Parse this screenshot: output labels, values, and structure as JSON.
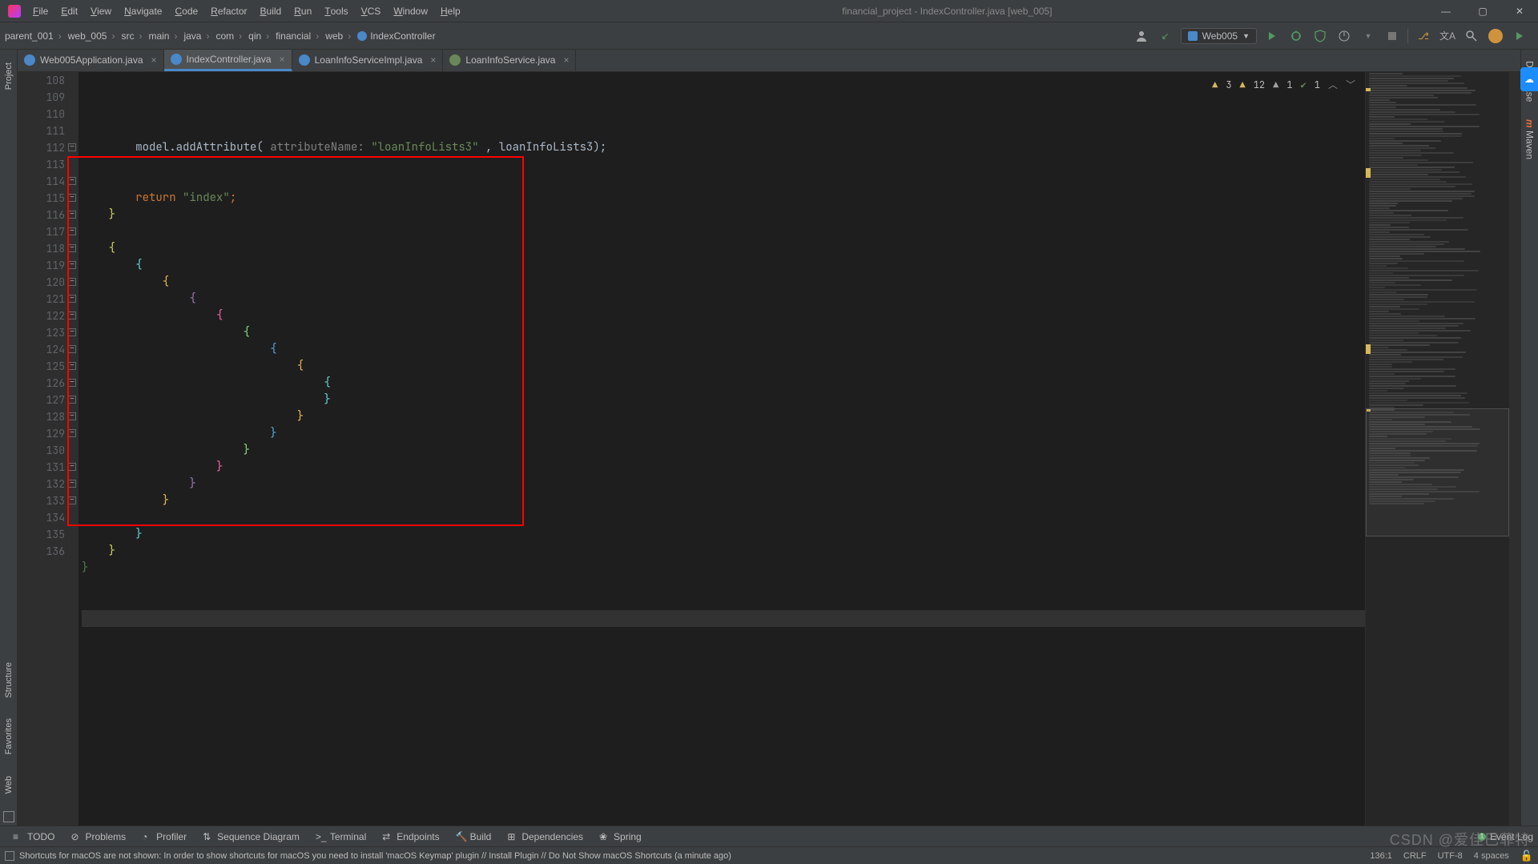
{
  "window": {
    "title": "financial_project - IndexController.java [web_005]"
  },
  "menu": [
    "File",
    "Edit",
    "View",
    "Navigate",
    "Code",
    "Refactor",
    "Build",
    "Run",
    "Tools",
    "VCS",
    "Window",
    "Help"
  ],
  "breadcrumbs": [
    "parent_001",
    "web_005",
    "src",
    "main",
    "java",
    "com",
    "qin",
    "financial",
    "web",
    "IndexController"
  ],
  "run_config": {
    "label": "Web005"
  },
  "tabs": [
    {
      "label": "Web005Application.java",
      "active": false,
      "color": "#4a88c7"
    },
    {
      "label": "IndexController.java",
      "active": true,
      "color": "#4a88c7"
    },
    {
      "label": "LoanInfoServiceImpl.java",
      "active": false,
      "color": "#4a88c7"
    },
    {
      "label": "LoanInfoService.java",
      "active": false,
      "color": "#6a8759"
    }
  ],
  "editor": {
    "first_line": 108,
    "lines": [
      {
        "n": 108,
        "raw": [
          {
            "t": "        model.addAttribute( ",
            "c": "#a9b7c6"
          },
          {
            "t": "attributeName:",
            "c": "#808080"
          },
          {
            "t": " \"loanInfoLists3\" ",
            "c": "#6a8759"
          },
          {
            "t": ", loanInfoLists3);",
            "c": "#a9b7c6"
          }
        ]
      },
      {
        "n": 109,
        "raw": []
      },
      {
        "n": 110,
        "raw": []
      },
      {
        "n": 111,
        "raw": [
          {
            "t": "        ",
            "c": ""
          },
          {
            "t": "return ",
            "c": "#cc7832"
          },
          {
            "t": "\"index\"",
            "c": "#6a8759"
          },
          {
            "t": ";",
            "c": "#cc7832"
          }
        ]
      },
      {
        "n": 112,
        "raw": [
          {
            "t": "    }",
            "c": "#cccc66"
          }
        ],
        "fold": true
      },
      {
        "n": 113,
        "raw": []
      },
      {
        "n": 114,
        "raw": [
          {
            "t": "    {",
            "c": "#cccc66"
          }
        ],
        "fold": true
      },
      {
        "n": 115,
        "raw": [
          {
            "t": "        {",
            "c": "#66cccc"
          }
        ],
        "fold": true
      },
      {
        "n": 116,
        "raw": [
          {
            "t": "            {",
            "c": "#e4b555"
          }
        ],
        "fold": true
      },
      {
        "n": 117,
        "raw": [
          {
            "t": "                {",
            "c": "#9876aa"
          }
        ],
        "fold": true
      },
      {
        "n": 118,
        "raw": [
          {
            "t": "                    {",
            "c": "#e864a3"
          }
        ],
        "fold": true
      },
      {
        "n": 119,
        "raw": [
          {
            "t": "                        {",
            "c": "#87d37c"
          }
        ],
        "fold": true
      },
      {
        "n": 120,
        "raw": [
          {
            "t": "                            {",
            "c": "#53a2d8"
          }
        ],
        "fold": true
      },
      {
        "n": 121,
        "raw": [
          {
            "t": "                                {",
            "c": "#e4b555"
          }
        ],
        "fold": true
      },
      {
        "n": 122,
        "raw": [
          {
            "t": "                                    {",
            "c": "#66cccc"
          }
        ],
        "fold": true
      },
      {
        "n": 123,
        "raw": [
          {
            "t": "                                    }",
            "c": "#66cccc"
          }
        ],
        "fold": true
      },
      {
        "n": 124,
        "raw": [
          {
            "t": "                                }",
            "c": "#e4b555"
          }
        ],
        "fold": true
      },
      {
        "n": 125,
        "raw": [
          {
            "t": "                            }",
            "c": "#53a2d8"
          }
        ],
        "fold": true
      },
      {
        "n": 126,
        "raw": [
          {
            "t": "                        }",
            "c": "#87d37c"
          }
        ],
        "fold": true
      },
      {
        "n": 127,
        "raw": [
          {
            "t": "                    }",
            "c": "#e864a3"
          }
        ],
        "fold": true
      },
      {
        "n": 128,
        "raw": [
          {
            "t": "                }",
            "c": "#9876aa"
          }
        ],
        "fold": true
      },
      {
        "n": 129,
        "raw": [
          {
            "t": "            }",
            "c": "#e4b555"
          }
        ],
        "fold": true
      },
      {
        "n": 130,
        "raw": []
      },
      {
        "n": 131,
        "raw": [
          {
            "t": "        }",
            "c": "#66cccc"
          }
        ],
        "fold": true
      },
      {
        "n": 132,
        "raw": [
          {
            "t": "    }",
            "c": "#cccc66"
          }
        ],
        "fold": true
      },
      {
        "n": 133,
        "raw": [
          {
            "t": "}",
            "c": "#4d784e"
          }
        ],
        "fold": true
      },
      {
        "n": 134,
        "raw": []
      },
      {
        "n": 135,
        "raw": []
      },
      {
        "n": 136,
        "raw": [],
        "current": true
      }
    ],
    "inspection": {
      "w1": "3",
      "w2": "12",
      "w3": "1",
      "ok": "1"
    }
  },
  "left_tools": [
    "Project",
    "Structure",
    "Favorites",
    "Web"
  ],
  "right_tools": [
    "Database",
    "Maven"
  ],
  "bottom_tools": [
    "TODO",
    "Problems",
    "Profiler",
    "Sequence Diagram",
    "Terminal",
    "Endpoints",
    "Build",
    "Dependencies",
    "Spring"
  ],
  "event_log": {
    "label": "Event Log",
    "badge": "1"
  },
  "status": {
    "msg": "Shortcuts for macOS are not shown: In order to show shortcuts for macOS you need to install 'macOS Keymap' plugin // Install Plugin // Do Not Show macOS Shortcuts (a minute ago)",
    "pos": "136:1",
    "eol": "CRLF",
    "enc": "UTF-8",
    "indent": "4 spaces"
  },
  "watermark": "CSDN @爱佳巴菲特"
}
